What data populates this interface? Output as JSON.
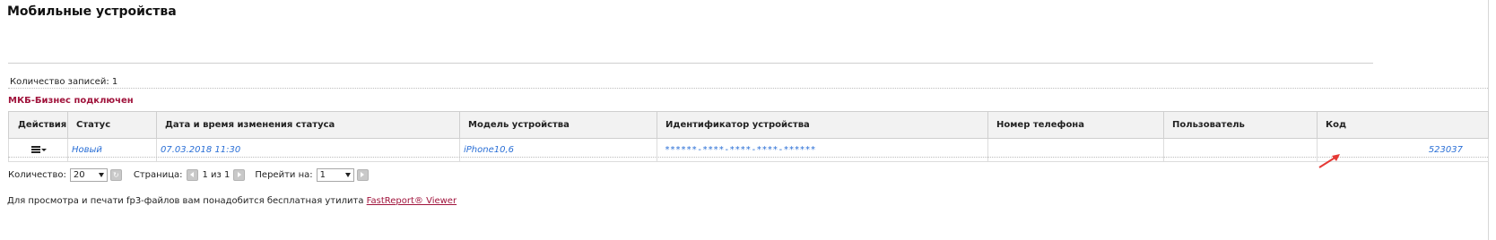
{
  "page": {
    "title": "Мобильные устройства"
  },
  "records": {
    "count_text": "Количество записей: 1"
  },
  "status_banner": {
    "text": "МКБ-Бизнес подключен",
    "color": "#a0143c"
  },
  "table": {
    "headers": {
      "actions": "Действия",
      "status": "Статус",
      "datetime": "Дата и время изменения статуса",
      "model": "Модель устройства",
      "device_id": "Идентификатор устройства",
      "phone": "Номер телефона",
      "user": "Пользователь",
      "code": "Код"
    },
    "rows": [
      {
        "actions_icon": "menu-dropdown-icon",
        "status": "Новый",
        "datetime": "07.03.2018 11:30",
        "model": "iPhone10,6",
        "device_id": "******-****-****-****-******",
        "phone": "",
        "user": "",
        "code": "523037"
      }
    ]
  },
  "pager": {
    "count_label": "Количество:",
    "count_value": "20",
    "page_label": "Страница:",
    "page_value": "1 из 1",
    "goto_label": "Перейти на:",
    "goto_value": "1",
    "icons": [
      "refresh-icon",
      "prev-page-icon",
      "next-page-icon",
      "go-icon"
    ]
  },
  "footer": {
    "note": "Для просмотра и печати fp3-файлов вам понадобится бесплатная утилита ",
    "link": "FastReport® Viewer"
  },
  "colors": {
    "link": "#2a6fd6",
    "accent": "#a0143c",
    "annotation_arrow": "#e53935"
  }
}
